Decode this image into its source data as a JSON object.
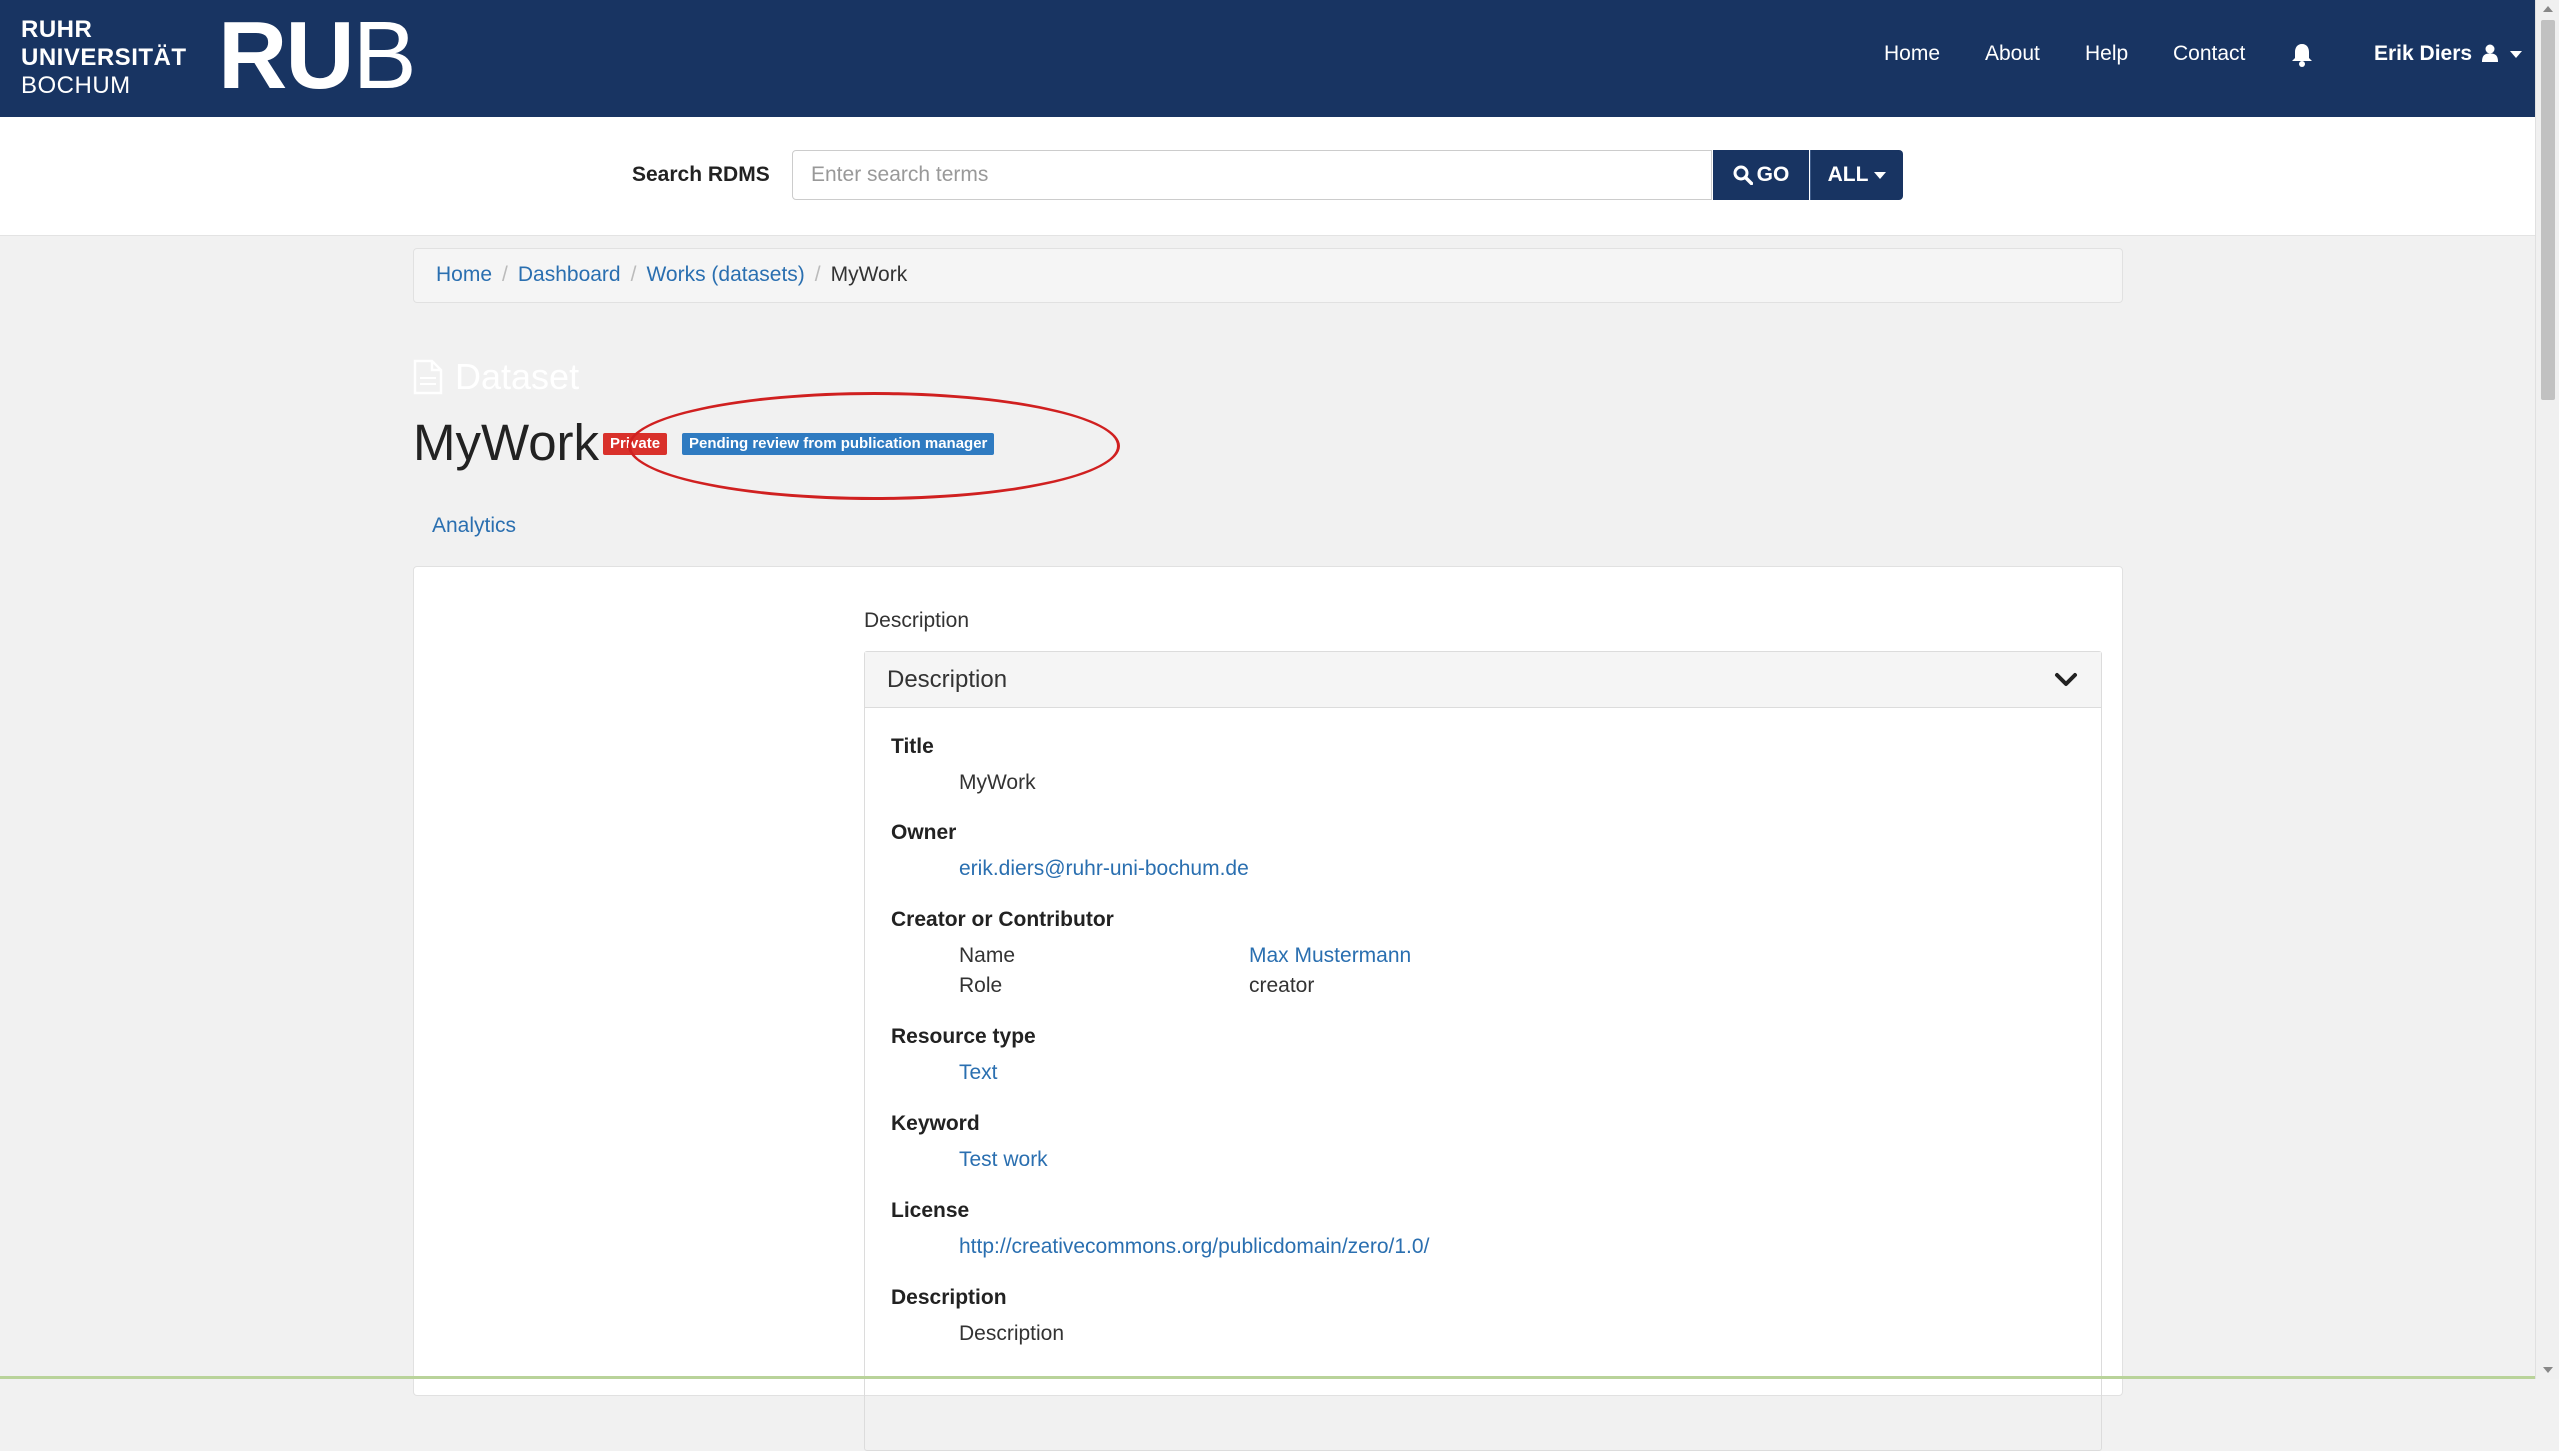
{
  "brand": {
    "line1": "RUHR",
    "line2": "UNIVERSITÄT",
    "line3": "BOCHUM",
    "logo_ru": "RU",
    "logo_b": "B"
  },
  "nav": {
    "links": [
      "Home",
      "About",
      "Help",
      "Contact"
    ],
    "user": "Erik Diers"
  },
  "search": {
    "label": "Search RDMS",
    "placeholder": "Enter search terms",
    "go_label": "GO",
    "scope_label": "ALL"
  },
  "breadcrumb": {
    "items": [
      "Home",
      "Dashboard",
      "Works (datasets)"
    ],
    "current": "MyWork"
  },
  "dataset": {
    "kind_label": "Dataset",
    "title": "MyWork",
    "badges": {
      "private": "Private",
      "pending": "Pending review from publication manager"
    },
    "analytics_label": "Analytics"
  },
  "description_panel": {
    "section_label": "Description",
    "header": "Description",
    "fields": {
      "title_label": "Title",
      "title_value": "MyWork",
      "owner_label": "Owner",
      "owner_value": "erik.diers@ruhr-uni-bochum.de",
      "creator_label": "Creator or Contributor",
      "creator_name_key": "Name",
      "creator_name_value": "Max Mustermann",
      "creator_role_key": "Role",
      "creator_role_value": "creator",
      "resource_label": "Resource type",
      "resource_value": "Text",
      "keyword_label": "Keyword",
      "keyword_value": "Test work",
      "license_label": "License",
      "license_value": "http://creativecommons.org/publicdomain/zero/1.0/",
      "description_label": "Description",
      "description_value": "Description"
    }
  },
  "colors": {
    "navbar": "#183462",
    "private_badge": "#d9312b",
    "pending_badge": "#2f7bc1",
    "link": "#2a6fb0",
    "annotation": "#d02020"
  },
  "icons": [
    "search-icon",
    "bell-icon",
    "user-icon",
    "caret-down-icon",
    "document-icon",
    "chevron-down-icon"
  ]
}
